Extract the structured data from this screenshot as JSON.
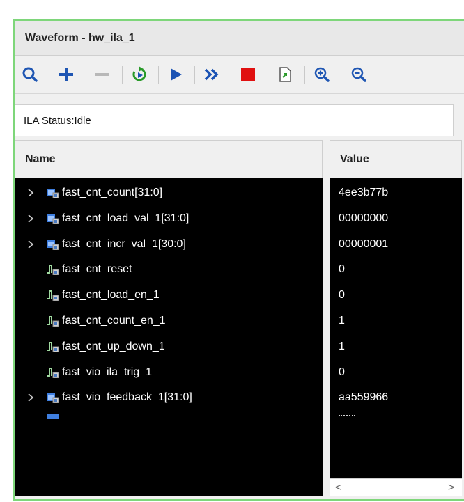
{
  "window": {
    "title": "Waveform - hw_ila_1"
  },
  "toolbar": {
    "buttons": [
      {
        "icon": "search-icon"
      },
      {
        "icon": "plus-icon"
      },
      {
        "icon": "minus-icon"
      },
      {
        "icon": "run-trigger-immediate-icon"
      },
      {
        "icon": "run-trigger-icon"
      },
      {
        "icon": "fast-forward-icon"
      },
      {
        "icon": "stop-icon"
      },
      {
        "icon": "export-icon"
      },
      {
        "icon": "zoom-in-icon"
      },
      {
        "icon": "zoom-out-icon"
      }
    ],
    "colors": {
      "accent_blue": "#1f56b3",
      "play_blue": "#1a52b4",
      "stop_red": "#e01010",
      "trigger_green": "#2a9a2a"
    }
  },
  "status": {
    "text": "ILA Status:Idle"
  },
  "columns": {
    "name": "Name",
    "value": "Value"
  },
  "signals": [
    {
      "name": "fast_cnt_count[31:0]",
      "value": "4ee3b77b",
      "type": "bus",
      "expandable": true
    },
    {
      "name": "fast_cnt_load_val_1[31:0]",
      "value": "00000000",
      "type": "bus",
      "expandable": true
    },
    {
      "name": "fast_cnt_incr_val_1[30:0]",
      "value": "00000001",
      "type": "bus",
      "expandable": true
    },
    {
      "name": "fast_cnt_reset",
      "value": "0",
      "type": "bit",
      "expandable": false
    },
    {
      "name": "fast_cnt_load_en_1",
      "value": "0",
      "type": "bit",
      "expandable": false
    },
    {
      "name": "fast_cnt_count_en_1",
      "value": "1",
      "type": "bit",
      "expandable": false
    },
    {
      "name": "fast_cnt_up_down_1",
      "value": "1",
      "type": "bit",
      "expandable": false
    },
    {
      "name": "fast_vio_ila_trig_1",
      "value": "0",
      "type": "bit",
      "expandable": false
    },
    {
      "name": "fast_vio_feedback_1[31:0]",
      "value": "aa559966",
      "type": "bus",
      "expandable": true
    }
  ],
  "scrollbar": {
    "left_arrow": "<",
    "right_arrow": ">"
  }
}
